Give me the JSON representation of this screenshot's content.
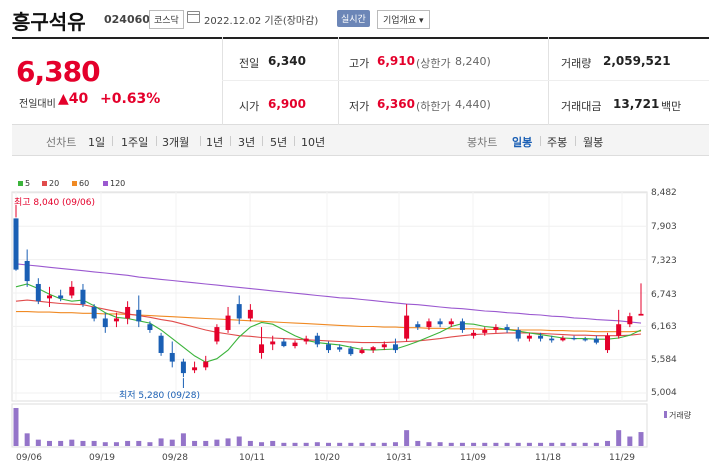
{
  "header": {
    "stock_name": "흥구석유",
    "stock_code": "024060",
    "market": "코스닥",
    "date_text": "2022.12.02 기준(장마감)",
    "live_label": "실시간",
    "company_info_label": "기업개요 ▾"
  },
  "summary": {
    "price": "6,380",
    "change_label": "전일대비",
    "change_value": "▲40",
    "change_pct": "+0.63%",
    "prev_close_label": "전일",
    "prev_close": "6,340",
    "high_label": "고가",
    "high": "6,910",
    "upper_limit_label": "(상한가",
    "upper_limit": "8,240)",
    "volume_label": "거래량",
    "volume": "2,059,521",
    "open_label": "시가",
    "open": "6,900",
    "low_label": "저가",
    "low": "6,360",
    "lower_limit_label": "(하한가",
    "lower_limit": "4,440)",
    "amount_label": "거래대금",
    "amount": "13,721",
    "amount_unit": "백만"
  },
  "tabs": {
    "line_chart_label": "선차트",
    "periods": [
      "1일",
      "1주일",
      "3개월",
      "1년",
      "3년",
      "5년",
      "10년"
    ],
    "candle_chart_label": "봉차트",
    "candle_periods": [
      "일봉",
      "주봉",
      "월봉"
    ],
    "selected_candle": "일봉"
  },
  "chart_data": {
    "type": "candlestick",
    "legend": [
      {
        "name": "5",
        "color": "#3cb43c"
      },
      {
        "name": "20",
        "color": "#e04b4b"
      },
      {
        "name": "60",
        "color": "#f08a24"
      },
      {
        "name": "120",
        "color": "#9b59d0"
      }
    ],
    "y_ticks": [
      "8,482",
      "7,903",
      "7,323",
      "6,743",
      "6,163",
      "5,584",
      "5,004"
    ],
    "x_ticks": [
      "09/06",
      "09/19",
      "09/28",
      "10/11",
      "10/20",
      "10/31",
      "11/09",
      "11/18",
      "11/29"
    ],
    "ylim": [
      5004,
      8482
    ],
    "annotations": {
      "high": "최고 8,040 (09/06)",
      "low": "최저 5,280 (09/28)"
    },
    "volume_label": "거래량",
    "colors": {
      "up": "#e4002b",
      "down": "#1a5fb4",
      "volume": "#9474c9"
    },
    "candles": [
      {
        "o": 8040,
        "h": 8040,
        "l": 7130,
        "c": 7150
      },
      {
        "o": 7300,
        "h": 7500,
        "l": 6850,
        "c": 6950
      },
      {
        "o": 6900,
        "h": 7000,
        "l": 6550,
        "c": 6600
      },
      {
        "o": 6650,
        "h": 6850,
        "l": 6500,
        "c": 6700
      },
      {
        "o": 6700,
        "h": 6800,
        "l": 6600,
        "c": 6650
      },
      {
        "o": 6700,
        "h": 6950,
        "l": 6650,
        "c": 6850
      },
      {
        "o": 6800,
        "h": 6900,
        "l": 6500,
        "c": 6550
      },
      {
        "o": 6500,
        "h": 6550,
        "l": 6250,
        "c": 6300
      },
      {
        "o": 6300,
        "h": 6400,
        "l": 6050,
        "c": 6150
      },
      {
        "o": 6250,
        "h": 6400,
        "l": 6150,
        "c": 6300
      },
      {
        "o": 6300,
        "h": 6600,
        "l": 6200,
        "c": 6500
      },
      {
        "o": 6450,
        "h": 6700,
        "l": 6150,
        "c": 6250
      },
      {
        "o": 6200,
        "h": 6250,
        "l": 6050,
        "c": 6100
      },
      {
        "o": 6000,
        "h": 6050,
        "l": 5650,
        "c": 5700
      },
      {
        "o": 5700,
        "h": 5900,
        "l": 5450,
        "c": 5550
      },
      {
        "o": 5550,
        "h": 5600,
        "l": 5280,
        "c": 5350
      },
      {
        "o": 5400,
        "h": 5550,
        "l": 5350,
        "c": 5450
      },
      {
        "o": 5450,
        "h": 5650,
        "l": 5400,
        "c": 5550
      },
      {
        "o": 5900,
        "h": 6200,
        "l": 5850,
        "c": 6150
      },
      {
        "o": 6100,
        "h": 6500,
        "l": 6050,
        "c": 6350
      },
      {
        "o": 6550,
        "h": 6700,
        "l": 6200,
        "c": 6300
      },
      {
        "o": 6300,
        "h": 6550,
        "l": 6250,
        "c": 6450
      },
      {
        "o": 5700,
        "h": 6150,
        "l": 5600,
        "c": 5850
      },
      {
        "o": 5850,
        "h": 6000,
        "l": 5750,
        "c": 5900
      },
      {
        "o": 5900,
        "h": 5950,
        "l": 5800,
        "c": 5820
      },
      {
        "o": 5820,
        "h": 5920,
        "l": 5780,
        "c": 5880
      },
      {
        "o": 5900,
        "h": 6000,
        "l": 5850,
        "c": 5950
      },
      {
        "o": 6000,
        "h": 6050,
        "l": 5800,
        "c": 5850
      },
      {
        "o": 5850,
        "h": 5900,
        "l": 5700,
        "c": 5750
      },
      {
        "o": 5800,
        "h": 5850,
        "l": 5720,
        "c": 5760
      },
      {
        "o": 5780,
        "h": 5820,
        "l": 5650,
        "c": 5680
      },
      {
        "o": 5700,
        "h": 5800,
        "l": 5680,
        "c": 5750
      },
      {
        "o": 5750,
        "h": 5820,
        "l": 5700,
        "c": 5800
      },
      {
        "o": 5800,
        "h": 5900,
        "l": 5750,
        "c": 5850
      },
      {
        "o": 5850,
        "h": 5950,
        "l": 5700,
        "c": 5750
      },
      {
        "o": 5950,
        "h": 6550,
        "l": 5900,
        "c": 6350
      },
      {
        "o": 6200,
        "h": 6250,
        "l": 6100,
        "c": 6150
      },
      {
        "o": 6150,
        "h": 6300,
        "l": 6100,
        "c": 6250
      },
      {
        "o": 6250,
        "h": 6300,
        "l": 6150,
        "c": 6200
      },
      {
        "o": 6200,
        "h": 6300,
        "l": 6150,
        "c": 6250
      },
      {
        "o": 6250,
        "h": 6300,
        "l": 6050,
        "c": 6100
      },
      {
        "o": 6000,
        "h": 6100,
        "l": 5950,
        "c": 6050
      },
      {
        "o": 6050,
        "h": 6150,
        "l": 6000,
        "c": 6100
      },
      {
        "o": 6100,
        "h": 6200,
        "l": 6050,
        "c": 6150
      },
      {
        "o": 6150,
        "h": 6200,
        "l": 6050,
        "c": 6100
      },
      {
        "o": 6100,
        "h": 6150,
        "l": 5900,
        "c": 5950
      },
      {
        "o": 5950,
        "h": 6050,
        "l": 5900,
        "c": 6000
      },
      {
        "o": 6000,
        "h": 6050,
        "l": 5900,
        "c": 5950
      },
      {
        "o": 5950,
        "h": 6000,
        "l": 5880,
        "c": 5920
      },
      {
        "o": 5920,
        "h": 6000,
        "l": 5900,
        "c": 5960
      },
      {
        "o": 5960,
        "h": 6000,
        "l": 5920,
        "c": 5940
      },
      {
        "o": 5940,
        "h": 5980,
        "l": 5900,
        "c": 5920
      },
      {
        "o": 5950,
        "h": 6000,
        "l": 5850,
        "c": 5880
      },
      {
        "o": 5750,
        "h": 6050,
        "l": 5700,
        "c": 6000
      },
      {
        "o": 6000,
        "h": 6450,
        "l": 5950,
        "c": 6200
      },
      {
        "o": 6200,
        "h": 6400,
        "l": 6150,
        "c": 6340
      },
      {
        "o": 6350,
        "h": 6910,
        "l": 6360,
        "c": 6380
      }
    ],
    "ma5": [
      6850,
      6900,
      6820,
      6720,
      6640,
      6600,
      6620,
      6520,
      6400,
      6320,
      6300,
      6260,
      6220,
      6100,
      5950,
      5800,
      5650,
      5540,
      5600,
      5750,
      5980,
      6150,
      6230,
      6200,
      6100,
      6000,
      5920,
      5880,
      5860,
      5840,
      5800,
      5760,
      5750,
      5760,
      5770,
      5830,
      5900,
      5980,
      6060,
      6160,
      6210,
      6200,
      6160,
      6140,
      6110,
      6080,
      6050,
      6020,
      5990,
      5960,
      5950,
      5950,
      5940,
      5940,
      5960,
      6010,
      6100
    ],
    "ma20": [
      6600,
      6620,
      6600,
      6580,
      6560,
      6550,
      6540,
      6500,
      6460,
      6420,
      6380,
      6350,
      6320,
      6280,
      6250,
      6200,
      6150,
      6100,
      6060,
      6030,
      6000,
      5990,
      5970,
      5960,
      5950,
      5940,
      5930,
      5920,
      5910,
      5900,
      5890,
      5880,
      5880,
      5880,
      5890,
      5900,
      5910,
      5930,
      5950,
      5980,
      6000,
      6020,
      6030,
      6040,
      6050,
      6050,
      6050,
      6040,
      6030,
      6020,
      6010,
      6010,
      6000,
      6000,
      6000,
      6010,
      6030
    ],
    "ma60": [
      6420,
      6420,
      6410,
      6410,
      6400,
      6400,
      6390,
      6390,
      6380,
      6380,
      6370,
      6360,
      6350,
      6340,
      6330,
      6320,
      6310,
      6300,
      6290,
      6280,
      6270,
      6260,
      6250,
      6240,
      6230,
      6220,
      6210,
      6200,
      6190,
      6180,
      6170,
      6160,
      6160,
      6150,
      6150,
      6140,
      6140,
      6130,
      6130,
      6120,
      6120,
      6120,
      6110,
      6110,
      6110,
      6100,
      6100,
      6100,
      6090,
      6090,
      6080,
      6080,
      6070,
      6070,
      6070,
      6070,
      6080
    ],
    "ma120": [
      7250,
      7230,
      7210,
      7190,
      7170,
      7150,
      7130,
      7110,
      7090,
      7070,
      7050,
      7020,
      7000,
      6980,
      6960,
      6940,
      6920,
      6900,
      6880,
      6860,
      6840,
      6820,
      6800,
      6780,
      6760,
      6740,
      6720,
      6700,
      6680,
      6660,
      6650,
      6630,
      6610,
      6590,
      6570,
      6550,
      6540,
      6520,
      6500,
      6480,
      6470,
      6450,
      6430,
      6420,
      6400,
      6390,
      6370,
      6360,
      6340,
      6330,
      6310,
      6300,
      6280,
      6270,
      6260,
      6240,
      6220
    ],
    "volume": [
      60,
      20,
      10,
      8,
      8,
      10,
      8,
      8,
      6,
      6,
      8,
      8,
      6,
      12,
      10,
      20,
      8,
      8,
      10,
      12,
      15,
      8,
      6,
      8,
      5,
      5,
      5,
      6,
      5,
      5,
      5,
      5,
      5,
      5,
      6,
      25,
      8,
      6,
      6,
      5,
      5,
      5,
      5,
      5,
      5,
      5,
      5,
      5,
      5,
      5,
      5,
      5,
      5,
      8,
      25,
      15,
      22
    ]
  }
}
